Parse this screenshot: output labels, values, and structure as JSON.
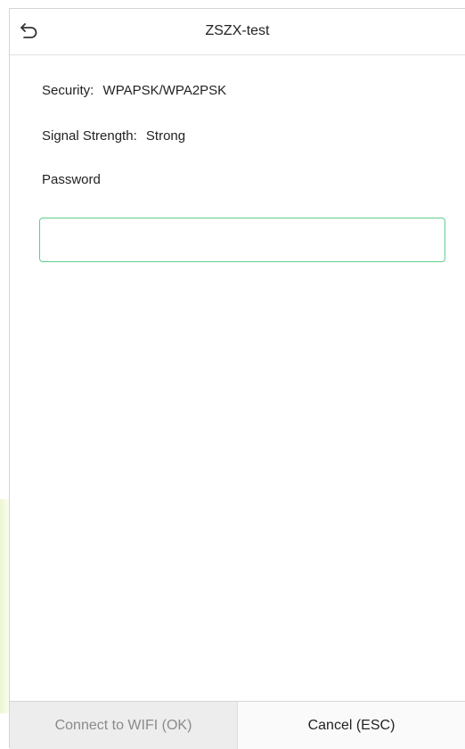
{
  "header": {
    "title": "ZSZX-test",
    "back_icon": "back-arrow-icon"
  },
  "info": {
    "security_label": "Security:",
    "security_value": "WPAPSK/WPA2PSK",
    "signal_label": "Signal Strength:",
    "signal_value": "Strong",
    "password_label": "Password"
  },
  "password_input": {
    "value": "",
    "placeholder": ""
  },
  "footer": {
    "connect_label": "Connect to WIFI (OK)",
    "cancel_label": "Cancel (ESC)"
  },
  "colors": {
    "input_border": "#5fcf8d",
    "disabled_text": "#8a8a8a"
  }
}
